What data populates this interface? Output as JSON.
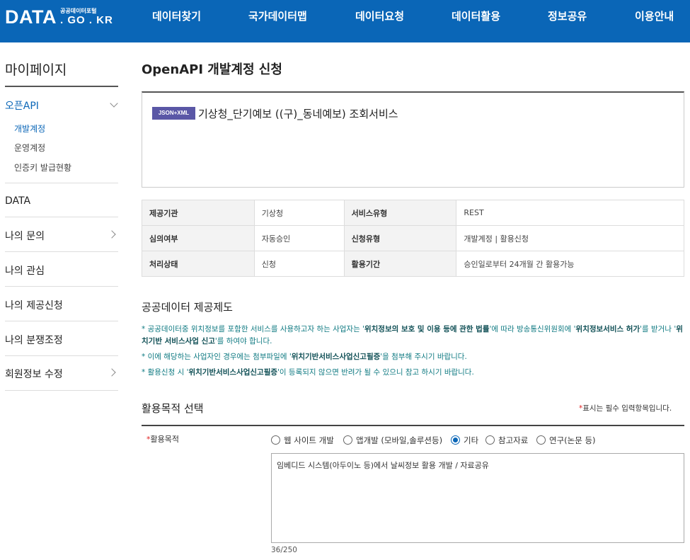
{
  "header": {
    "logo_main": "DATA",
    "logo_sub_small": "공공데이터포털",
    "logo_sub_big": ". GO . KR",
    "nav": [
      "데이터찾기",
      "국가데이터맵",
      "데이터요청",
      "데이터활용",
      "정보공유",
      "이용안내"
    ],
    "bg_color": "#0a66b7"
  },
  "sidebar": {
    "title": "마이페이지",
    "openapi": {
      "label": "오픈API",
      "items": [
        "개발계정",
        "운영계정",
        "인증키 발급현황"
      ]
    },
    "sections": [
      "DATA",
      "나의 문의",
      "나의 관심",
      "나의 제공신청",
      "나의 분쟁조정",
      "회원정보 수정"
    ]
  },
  "main": {
    "page_title": "OpenAPI 개발계정 신청",
    "service": {
      "badge": "JSON+XML",
      "name": "기상청_단기예보 ((구)_동네예보) 조회서비스"
    },
    "info": {
      "rows": [
        [
          {
            "k": "제공기관",
            "v": "기상청"
          },
          {
            "k": "서비스유형",
            "v": "REST"
          }
        ],
        [
          {
            "k": "심의여부",
            "v": "자동승인"
          },
          {
            "k": "신청유형",
            "v": "개발계정 | 활용신청"
          }
        ],
        [
          {
            "k": "처리상태",
            "v": "신청"
          },
          {
            "k": "활용기간",
            "v": "승인일로부터 24개월 간 활용가능"
          }
        ]
      ]
    },
    "policy": {
      "title": "공공데이터 제공제도",
      "notices": [
        {
          "a": "* 공공데이터중 위치정보를 포함한 서비스를 사용하고자 하는 사업자는 '",
          "b": "위치정보의 보호 및 이용 등에 관한 법률",
          "c": "'에 따라 방송통신위원회에 '",
          "d": "위치정보서비스 허가",
          "e": "'를 받거나 '",
          "f": "위치기반 서비스사업 신고",
          "g": "'를 하여야 합니다."
        },
        {
          "a": "* 이에 해당하는 사업자인 경우에는 첨부파일에 '",
          "b": "위치기반서비스사업신고필증",
          "c": "'을 첨부해 주시기 바랍니다."
        },
        {
          "a": "* 활용신청 시 '",
          "b": "위치기반서비스사업신고필증",
          "c": "'이 등록되지 않으면 반려가 될 수 있으니 참고 하시기 바랍니다."
        }
      ]
    },
    "purpose": {
      "title": "활용목적 선택",
      "required_note_star": "*",
      "required_note": "표시는 필수 입력항목입니다.",
      "label_star": "*",
      "label": "활용목적",
      "options": [
        "웹 사이트 개발",
        "앱개발 (모바일,솔루션등)",
        "기타",
        "참고자료",
        "연구(논문 등)"
      ],
      "selected": "기타",
      "text": "임베디드 시스템(아두이노 등)에서 날씨정보 활용 개발 / 자료공유",
      "count": "36/250"
    }
  }
}
